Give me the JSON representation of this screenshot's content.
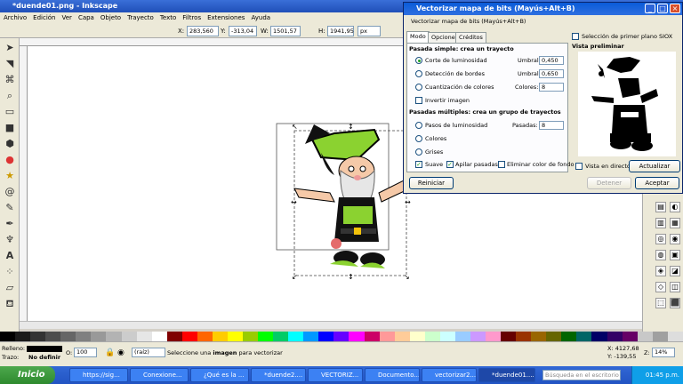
{
  "window": {
    "title": "*duende01.png - Inkscape"
  },
  "menu": [
    "Archivo",
    "Edición",
    "Ver",
    "Capa",
    "Objeto",
    "Trayecto",
    "Texto",
    "Filtros",
    "Extensiones",
    "Ayuda"
  ],
  "controls": {
    "x_label": "X:",
    "x_value": "283,560",
    "y_label": "Y:",
    "y_value": "-313,04",
    "w_label": "W:",
    "w_value": "1501,57",
    "h_label": "H:",
    "h_value": "1941,95",
    "unit": "px"
  },
  "dialog": {
    "title": "Vectorizar mapa de bits (Mayús+Alt+B)",
    "subtitle": "Vectorizar mapa de bits (Mayús+Alt+B)",
    "tabs": [
      "Modo",
      "Opciones",
      "Créditos"
    ],
    "single_scan_heading": "Pasada simple: crea un trayecto",
    "options": [
      {
        "label": "Corte de luminosidad",
        "param": "Umbral:",
        "value": "0,450"
      },
      {
        "label": "Detección de bordes",
        "param": "Umbral:",
        "value": "0,650"
      },
      {
        "label": "Cuantización de colores",
        "param": "Colores:",
        "value": "8"
      }
    ],
    "invert_label": "Invertir imagen",
    "multi_scan_heading": "Pasadas múltiples: crea un grupo de trayectos",
    "multi_options": [
      {
        "label": "Pasos de luminosidad",
        "param": "Pasadas:",
        "value": "8"
      },
      {
        "label": "Colores"
      },
      {
        "label": "Grises"
      }
    ],
    "smooth_label": "Suave",
    "stack_label": "Apilar pasadas",
    "remove_bg_label": "Eliminar color de fondo",
    "siox_label": "Selección de primer plano SIOX",
    "preview_heading": "Vista preliminar",
    "live_preview_label": "Vista en directo",
    "update_button": "Actualizar",
    "reset_button": "Reiniciar",
    "stop_button": "Detener",
    "accept_button": "Aceptar"
  },
  "status": {
    "fill_label": "Relleno:",
    "stroke_label": "Trazo:",
    "stroke_value": "No definir",
    "opacity_label": "O:",
    "opacity_value": "100",
    "layer_value": "(raíz)",
    "message_prefix": "Seleccione una ",
    "message_bold": "imagen",
    "message_suffix": " para vectorizar",
    "coord_x": "X: 4127,68",
    "coord_y": "Y: -139,55",
    "zoom_label": "Z:",
    "zoom_value": "14%"
  },
  "taskbar": {
    "start": "Inicio",
    "buttons": [
      "https://sig...",
      "Conexione...",
      "¿Qué es la ...",
      "*duende2....",
      "VECTORIZ...",
      "Documento...",
      "vectorizar2...",
      "*duende01...."
    ],
    "search_placeholder": "Búsqueda en el escritorio",
    "clock": "01:45 p.m."
  },
  "palette_colors": [
    "#000000",
    "#1a1a1a",
    "#333333",
    "#4d4d4d",
    "#666666",
    "#808080",
    "#999999",
    "#b3b3b3",
    "#cccccc",
    "#e6e6e6",
    "#ffffff",
    "#800000",
    "#ff0000",
    "#ff6600",
    "#ffcc00",
    "#ffff00",
    "#99cc00",
    "#00ff00",
    "#00cc66",
    "#00ffff",
    "#0099ff",
    "#0000ff",
    "#6600ff",
    "#ff00ff",
    "#cc0066",
    "#ff9999",
    "#ffcc99",
    "#ffffcc",
    "#ccffcc",
    "#ccffff",
    "#99ccff",
    "#cc99ff",
    "#ff99cc",
    "#660000",
    "#993300",
    "#996600",
    "#666600",
    "#006600",
    "#006666",
    "#000066",
    "#330066",
    "#660066",
    "#c8c8c8",
    "#a0a0a0",
    "#dddddd"
  ]
}
